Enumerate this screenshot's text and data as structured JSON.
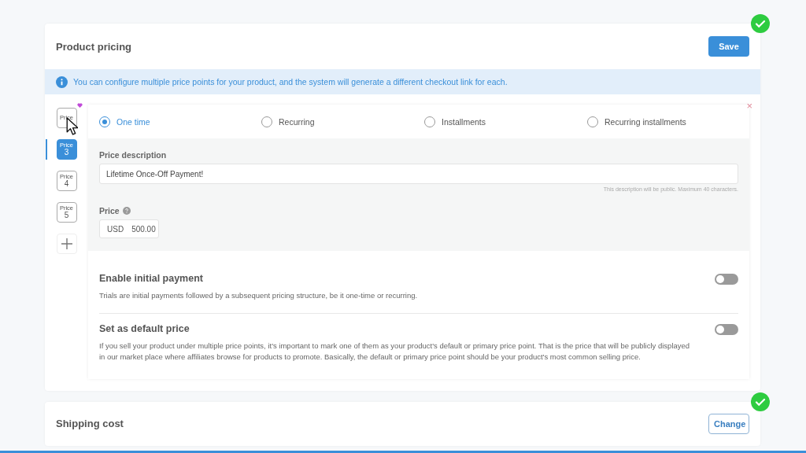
{
  "product_pricing": {
    "title": "Product pricing",
    "complete": true,
    "save_button": "Save",
    "info": "You can configure multiple price points for your product, and the system will generate a different checkout link for each.",
    "price_tabs": [
      {
        "label": "Price",
        "selected": false,
        "flagged": true
      },
      {
        "label": "Price",
        "number": "3",
        "selected": true,
        "flagged": false
      },
      {
        "label": "Price",
        "number": "4",
        "selected": false,
        "flagged": false
      },
      {
        "label": "Price",
        "number": "5",
        "selected": false,
        "flagged": false
      }
    ],
    "close": "×",
    "pricing_types": [
      {
        "label": "One time",
        "selected": true
      },
      {
        "label": "Recurring",
        "selected": false
      },
      {
        "label": "Installments",
        "selected": false
      },
      {
        "label": "Recurring installments",
        "selected": false
      }
    ],
    "description": {
      "label": "Price description",
      "value": "Lifetime Once-Off Payment!",
      "hint": "This description will be public. Maximum 40 characters."
    },
    "price": {
      "label": "Price",
      "currency": "USD",
      "value": "500.00"
    },
    "options": [
      {
        "title": "Enable initial payment",
        "text": "Trials are initial payments followed by a subsequent pricing structure, be it one-time or recurring.",
        "on": false
      },
      {
        "title": "Set as default price",
        "text": "If you sell your product under multiple price points, it's important to mark one of them as your product's default or primary price point. That is the price that will be publicly displayed in our market place where affiliates browse for products to promote. Basically, the default or primary price point should be your product's most common selling price.",
        "on": false
      }
    ]
  },
  "shipping": {
    "title": "Shipping cost",
    "complete": true,
    "button": "Change"
  }
}
